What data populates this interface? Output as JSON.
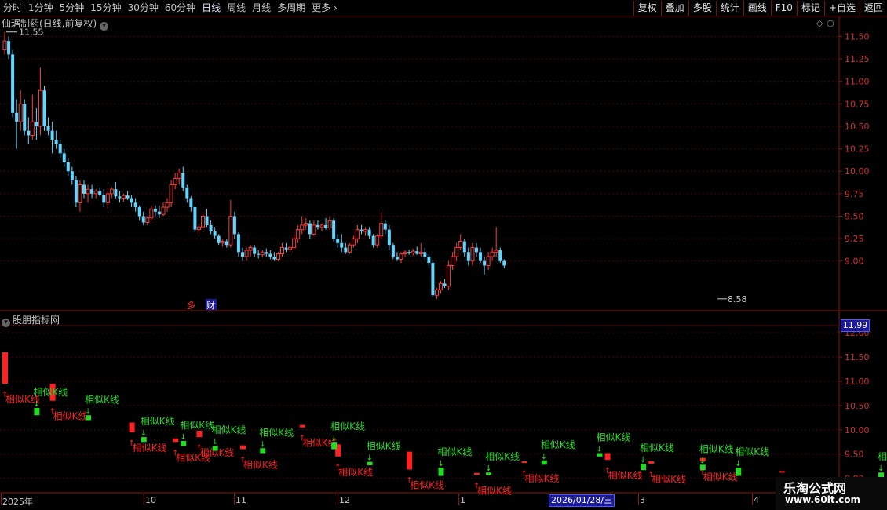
{
  "toolbar": {
    "periods": [
      "分时",
      "1分钟",
      "5分钟",
      "15分钟",
      "30分钟",
      "60分钟",
      "日线",
      "周线",
      "月线",
      "多周期",
      "更多"
    ],
    "active_period": "日线",
    "buttons": [
      "复权",
      "叠加",
      "多股",
      "统计",
      "画线",
      "F10",
      "标记",
      "+自选",
      "返回"
    ]
  },
  "stock_title": "仙琚制药(日线,前复权)",
  "indicator_title": "股朋指标网",
  "high_label": "11.55",
  "low_label": "8.58",
  "price_box": "11.99",
  "date_box": "2026/01/28/三",
  "event_markers": [
    "多",
    "财"
  ],
  "x_labels": [
    {
      "text": "2025年",
      "x": 3
    },
    {
      "text": "10",
      "x": 185
    },
    {
      "text": "11",
      "x": 300
    },
    {
      "text": "12",
      "x": 432
    },
    {
      "text": "1",
      "x": 586
    },
    {
      "text": "3",
      "x": 815
    },
    {
      "text": "4",
      "x": 960
    }
  ],
  "watermark": {
    "line1": "乐淘公式网",
    "line2": "www.60lt.com"
  },
  "signal_label": "相似K线",
  "chart_data": {
    "type": "candlestick",
    "price_axis": {
      "ylim": [
        8.5,
        11.6
      ],
      "ticks": [
        "11.50",
        "11.25",
        "11.00",
        "10.75",
        "10.50",
        "10.25",
        "10.00",
        "9.75",
        "9.50",
        "9.25",
        "9.00"
      ]
    },
    "indicator_axis": {
      "ylim": [
        8.8,
        12.1
      ],
      "ticks": [
        "12.00",
        "11.50",
        "11.00",
        "10.50",
        "10.00",
        "9.50",
        "9.00"
      ]
    },
    "colors": {
      "up": "#ff3b3b",
      "down": "#5fd7ff",
      "signal_red": "#ff2020",
      "signal_green": "#22dd22",
      "grid": "#8a1515"
    },
    "candles": [
      [
        11.35,
        11.55,
        11.3,
        11.45
      ],
      [
        11.45,
        11.5,
        11.25,
        11.3
      ],
      [
        11.3,
        11.35,
        10.6,
        10.65
      ],
      [
        10.65,
        10.8,
        10.25,
        10.55
      ],
      [
        10.55,
        10.9,
        10.45,
        10.75
      ],
      [
        10.75,
        10.8,
        10.4,
        10.45
      ],
      [
        10.45,
        10.6,
        10.3,
        10.4
      ],
      [
        10.4,
        10.85,
        10.35,
        10.55
      ],
      [
        10.55,
        10.7,
        10.35,
        10.5
      ],
      [
        10.5,
        11.15,
        10.4,
        10.9
      ],
      [
        10.9,
        10.95,
        10.45,
        10.5
      ],
      [
        10.5,
        10.6,
        10.4,
        10.45
      ],
      [
        10.45,
        10.55,
        10.2,
        10.35
      ],
      [
        10.35,
        10.45,
        10.25,
        10.3
      ],
      [
        10.3,
        10.35,
        10.15,
        10.2
      ],
      [
        10.2,
        10.25,
        10.05,
        10.1
      ],
      [
        10.1,
        10.15,
        9.95,
        10.0
      ],
      [
        10.0,
        10.05,
        9.85,
        9.9
      ],
      [
        9.9,
        9.95,
        9.6,
        9.65
      ],
      [
        9.65,
        9.9,
        9.55,
        9.85
      ],
      [
        9.85,
        9.9,
        9.7,
        9.75
      ],
      [
        9.75,
        9.85,
        9.65,
        9.8
      ],
      [
        9.8,
        9.85,
        9.7,
        9.75
      ],
      [
        9.75,
        9.8,
        9.7,
        9.78
      ],
      [
        9.78,
        9.82,
        9.72,
        9.74
      ],
      [
        9.74,
        9.8,
        9.6,
        9.65
      ],
      [
        9.65,
        9.8,
        9.58,
        9.75
      ],
      [
        9.75,
        9.82,
        9.7,
        9.8
      ],
      [
        9.8,
        9.88,
        9.7,
        9.72
      ],
      [
        9.72,
        9.78,
        9.65,
        9.7
      ],
      [
        9.7,
        9.75,
        9.66,
        9.73
      ],
      [
        9.73,
        9.78,
        9.68,
        9.7
      ],
      [
        9.7,
        9.74,
        9.6,
        9.65
      ],
      [
        9.65,
        9.7,
        9.55,
        9.6
      ],
      [
        9.6,
        9.62,
        9.45,
        9.5
      ],
      [
        9.5,
        9.55,
        9.4,
        9.43
      ],
      [
        9.43,
        9.5,
        9.4,
        9.48
      ],
      [
        9.48,
        9.62,
        9.45,
        9.58
      ],
      [
        9.58,
        9.62,
        9.5,
        9.55
      ],
      [
        9.55,
        9.62,
        9.48,
        9.52
      ],
      [
        9.52,
        9.65,
        9.5,
        9.6
      ],
      [
        9.6,
        9.7,
        9.55,
        9.65
      ],
      [
        9.65,
        9.9,
        9.6,
        9.85
      ],
      [
        9.85,
        9.98,
        9.8,
        9.92
      ],
      [
        9.92,
        10.03,
        9.85,
        9.98
      ],
      [
        9.98,
        10.05,
        9.78,
        9.82
      ],
      [
        9.82,
        9.85,
        9.65,
        9.7
      ],
      [
        9.7,
        9.72,
        9.55,
        9.6
      ],
      [
        9.6,
        9.62,
        9.32,
        9.35
      ],
      [
        9.35,
        9.42,
        9.3,
        9.38
      ],
      [
        9.38,
        9.55,
        9.35,
        9.5
      ],
      [
        9.5,
        9.58,
        9.38,
        9.4
      ],
      [
        9.4,
        9.45,
        9.3,
        9.33
      ],
      [
        9.33,
        9.38,
        9.25,
        9.28
      ],
      [
        9.28,
        9.3,
        9.18,
        9.2
      ],
      [
        9.2,
        9.24,
        9.16,
        9.22
      ],
      [
        9.22,
        9.25,
        9.15,
        9.18
      ],
      [
        9.18,
        9.68,
        9.15,
        9.5
      ],
      [
        9.5,
        9.55,
        9.25,
        9.3
      ],
      [
        9.3,
        9.32,
        9.05,
        9.1
      ],
      [
        9.1,
        9.15,
        9.0,
        9.05
      ],
      [
        9.05,
        9.15,
        9.0,
        9.12
      ],
      [
        9.12,
        9.18,
        9.05,
        9.15
      ],
      [
        9.15,
        9.18,
        9.05,
        9.08
      ],
      [
        9.08,
        9.12,
        9.03,
        9.07
      ],
      [
        9.07,
        9.12,
        9.04,
        9.1
      ],
      [
        9.1,
        9.14,
        9.05,
        9.08
      ],
      [
        9.08,
        9.12,
        9.02,
        9.05
      ],
      [
        9.05,
        9.1,
        9.0,
        9.02
      ],
      [
        9.02,
        9.1,
        9.0,
        9.08
      ],
      [
        9.08,
        9.2,
        9.05,
        9.15
      ],
      [
        9.15,
        9.2,
        9.1,
        9.13
      ],
      [
        9.13,
        9.18,
        9.1,
        9.15
      ],
      [
        9.15,
        9.3,
        9.12,
        9.25
      ],
      [
        9.25,
        9.4,
        9.2,
        9.35
      ],
      [
        9.35,
        9.5,
        9.3,
        9.4
      ],
      [
        9.4,
        9.48,
        9.35,
        9.42
      ],
      [
        9.42,
        9.45,
        9.25,
        9.3
      ],
      [
        9.3,
        9.45,
        9.28,
        9.4
      ],
      [
        9.4,
        9.45,
        9.35,
        9.38
      ],
      [
        9.38,
        9.42,
        9.33,
        9.4
      ],
      [
        9.4,
        9.48,
        9.35,
        9.37
      ],
      [
        9.37,
        9.5,
        9.35,
        9.45
      ],
      [
        9.45,
        9.48,
        9.22,
        9.25
      ],
      [
        9.25,
        9.3,
        9.15,
        9.2
      ],
      [
        9.2,
        9.3,
        9.1,
        9.15
      ],
      [
        9.15,
        9.2,
        9.08,
        9.1
      ],
      [
        9.1,
        9.2,
        9.08,
        9.18
      ],
      [
        9.18,
        9.28,
        9.15,
        9.25
      ],
      [
        9.25,
        9.4,
        9.2,
        9.35
      ],
      [
        9.35,
        9.4,
        9.3,
        9.33
      ],
      [
        9.33,
        9.38,
        9.28,
        9.35
      ],
      [
        9.35,
        9.38,
        9.25,
        9.28
      ],
      [
        9.28,
        9.3,
        9.15,
        9.18
      ],
      [
        9.18,
        9.3,
        9.15,
        9.28
      ],
      [
        9.28,
        9.55,
        9.25,
        9.42
      ],
      [
        9.42,
        9.45,
        9.3,
        9.35
      ],
      [
        9.35,
        9.4,
        9.12,
        9.18
      ],
      [
        9.18,
        9.2,
        9.02,
        9.05
      ],
      [
        9.05,
        9.1,
        9.0,
        9.02
      ],
      [
        9.02,
        9.1,
        8.98,
        9.08
      ],
      [
        9.08,
        9.12,
        9.05,
        9.1
      ],
      [
        9.1,
        9.13,
        9.07,
        9.09
      ],
      [
        9.09,
        9.14,
        9.06,
        9.11
      ],
      [
        9.11,
        9.16,
        9.07,
        9.08
      ],
      [
        9.08,
        9.2,
        9.05,
        9.1
      ],
      [
        9.1,
        9.15,
        9.02,
        9.05
      ],
      [
        9.05,
        9.08,
        8.95,
        8.98
      ],
      [
        8.98,
        9.0,
        8.6,
        8.62
      ],
      [
        8.62,
        8.7,
        8.58,
        8.68
      ],
      [
        8.68,
        8.78,
        8.64,
        8.75
      ],
      [
        8.75,
        8.8,
        8.7,
        8.72
      ],
      [
        8.72,
        9.0,
        8.68,
        8.95
      ],
      [
        8.95,
        9.1,
        8.9,
        9.05
      ],
      [
        9.05,
        9.2,
        9.0,
        9.15
      ],
      [
        9.15,
        9.3,
        9.12,
        9.22
      ],
      [
        9.22,
        9.25,
        9.05,
        9.1
      ],
      [
        9.1,
        9.15,
        8.95,
        9.0
      ],
      [
        9.0,
        9.2,
        8.95,
        9.15
      ],
      [
        9.15,
        9.2,
        9.05,
        9.1
      ],
      [
        9.1,
        9.15,
        8.98,
        9.0
      ],
      [
        9.0,
        9.05,
        8.85,
        8.95
      ],
      [
        8.95,
        9.1,
        8.9,
        9.05
      ],
      [
        9.05,
        9.15,
        9.0,
        9.1
      ],
      [
        9.1,
        9.38,
        9.05,
        9.12
      ],
      [
        9.12,
        9.15,
        8.98,
        9.0
      ],
      [
        9.0,
        9.02,
        8.92,
        8.95
      ]
    ],
    "signals_red": [
      [
        0,
        10.95,
        11.6
      ],
      [
        12,
        10.6,
        10.95
      ],
      [
        32,
        9.95,
        10.15
      ],
      [
        43,
        9.75,
        9.82
      ],
      [
        49,
        9.85,
        9.98
      ],
      [
        60,
        9.6,
        9.68
      ],
      [
        75,
        10.05,
        10.1
      ],
      [
        84,
        9.45,
        9.7
      ],
      [
        102,
        9.18,
        9.55
      ],
      [
        119,
        9.07,
        9.11
      ],
      [
        131,
        9.32,
        9.35
      ],
      [
        152,
        9.38,
        9.52
      ],
      [
        163,
        9.3,
        9.35
      ],
      [
        176,
        9.35,
        9.42
      ],
      [
        196,
        9.12,
        9.15
      ],
      [
        228,
        9.05,
        9.12
      ]
    ],
    "signals_green": [
      [
        8,
        10.3,
        10.45
      ],
      [
        21,
        10.2,
        10.3
      ],
      [
        35,
        9.75,
        9.85
      ],
      [
        45,
        9.67,
        9.77
      ],
      [
        53,
        9.57,
        9.67
      ],
      [
        65,
        9.52,
        9.62
      ],
      [
        83,
        9.6,
        9.75
      ],
      [
        92,
        9.27,
        9.34
      ],
      [
        110,
        9.05,
        9.22
      ],
      [
        122,
        9.07,
        9.12
      ],
      [
        136,
        9.28,
        9.37
      ],
      [
        150,
        9.45,
        9.52
      ],
      [
        161,
        9.17,
        9.3
      ],
      [
        176,
        9.17,
        9.28
      ],
      [
        185,
        9.05,
        9.22
      ],
      [
        221,
        9.0,
        9.12
      ]
    ]
  }
}
